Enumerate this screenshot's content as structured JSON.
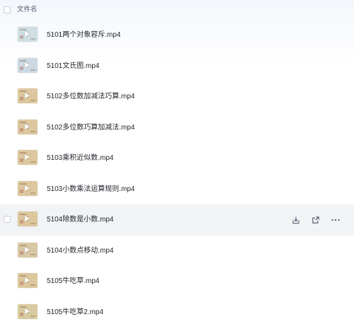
{
  "header": {
    "column_label": "文件名"
  },
  "files": [
    {
      "name": "5101两个对象容斥.mp4",
      "thumb_color": "#cfdfe4",
      "thumb_icon": "video-play-icon"
    },
    {
      "name": "5101文氏图.mp4",
      "thumb_color": "#cdd9e3",
      "thumb_icon": "video-play-icon"
    },
    {
      "name": "5102多位数加减法巧算.mp4",
      "thumb_color": "#dcc79f",
      "thumb_icon": "video-play-icon"
    },
    {
      "name": "5102多位数巧算加减法.mp4",
      "thumb_color": "#dcc79f",
      "thumb_icon": "video-play-icon"
    },
    {
      "name": "5103乘积近似数.mp4",
      "thumb_color": "#dcc79f",
      "thumb_icon": "video-play-icon"
    },
    {
      "name": "5103小数乘法运算规则.mp4",
      "thumb_color": "#dcc79f",
      "thumb_icon": "video-play-icon"
    },
    {
      "name": "5104除数是小数.mp4",
      "thumb_color": "#dcc79f",
      "thumb_icon": "video-play-icon"
    },
    {
      "name": "5104小数点移动.mp4",
      "thumb_color": "#d8c8a6",
      "thumb_icon": "video-play-icon"
    },
    {
      "name": "5105牛吃草.mp4",
      "thumb_color": "#dcc79f",
      "thumb_icon": "video-play-icon"
    },
    {
      "name": "5105牛吃草2.mp4",
      "thumb_color": "#d9cba1",
      "thumb_icon": "video-play-icon"
    }
  ],
  "hovered_row_index": 6,
  "row_actions": {
    "download_icon": "download-icon",
    "share_icon": "share-icon",
    "more_icon": "more-icon"
  }
}
